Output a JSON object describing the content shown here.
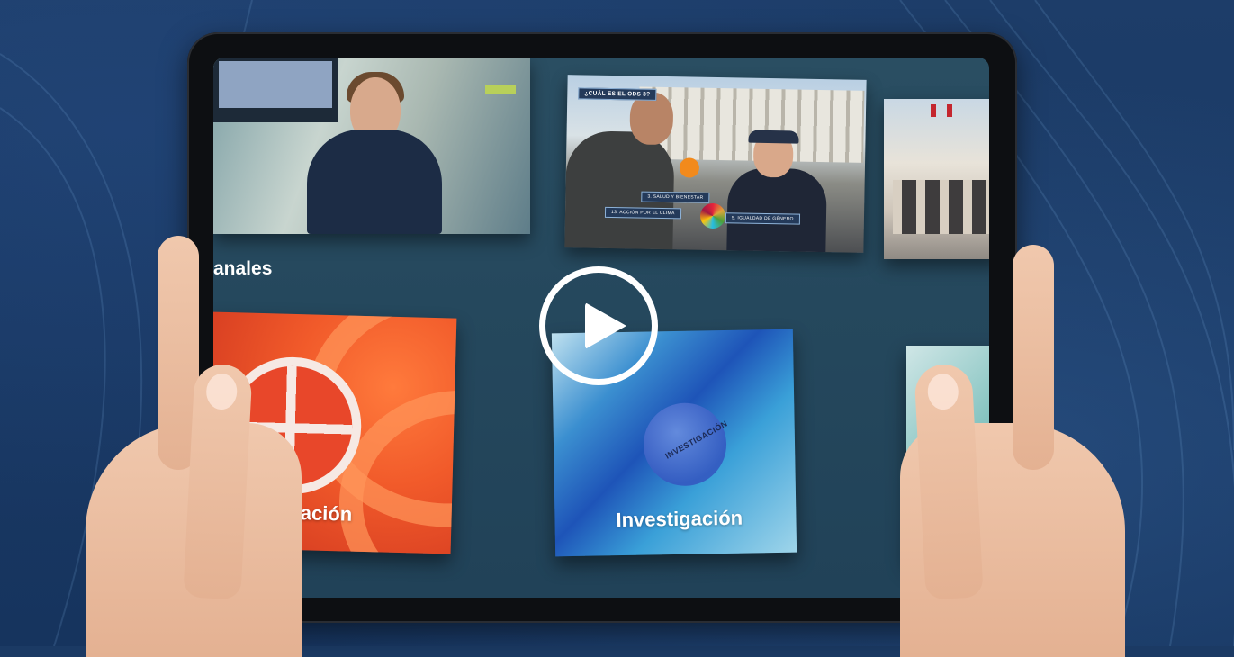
{
  "screen": {
    "section_title": "anales",
    "channels": [
      {
        "label": "ooperación"
      },
      {
        "label": "Investigación",
        "logo_text": "INVESTIGACIÓN"
      },
      {
        "label": ""
      }
    ],
    "thumbnails": [
      {
        "name": "hospital-interview"
      },
      {
        "name": "ods-street-interview",
        "overlay_question": "¿CUÁL ES EL ODS 3?",
        "overlay_options": [
          "3. SALUD Y BIENESTAR",
          "13. ACCIÓN POR EL CLIMA",
          "5. IGUALDAD DE GÉNERO"
        ]
      },
      {
        "name": "city-square"
      }
    ],
    "play_icon": "play-circle-icon"
  },
  "colors": {
    "background": "#1b3a64",
    "screen": "#25485d",
    "cooperacion_card": "#f15a2a",
    "investigacion_card": "#1e54b8"
  }
}
